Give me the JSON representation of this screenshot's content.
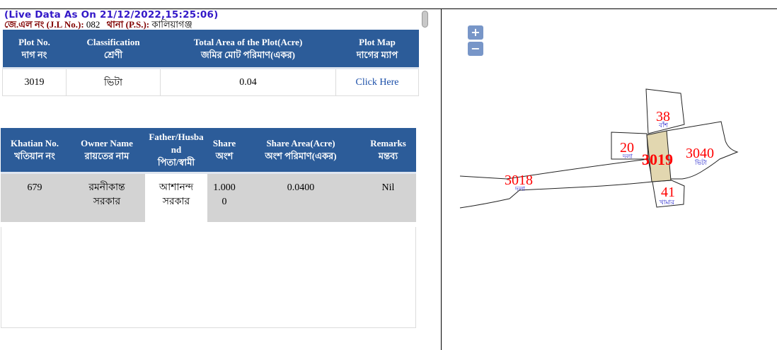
{
  "header": {
    "live_data": "(Live Data As On 21/12/2022,15:25:06)",
    "jl_label": "জে.এল নং (J.L No.):",
    "jl_value": "082",
    "ps_label": "থানা (P.S.):",
    "ps_value": "কালিয়াগঞ্জ"
  },
  "plot_table": {
    "headers": [
      {
        "en": "Plot No.",
        "bn": "দাগ নং"
      },
      {
        "en": "Classification",
        "bn": "শ্রেণী"
      },
      {
        "en": "Total Area of the Plot(Acre)",
        "bn": "জমির মোট পরিমাণ(একর)"
      },
      {
        "en": "Plot Map",
        "bn": "দাগের ম্যাপ"
      }
    ],
    "row": {
      "plot_no": "3019",
      "classification": "ভিটা",
      "total_area": "0.04",
      "plot_map_link": "Click Here"
    }
  },
  "owner_table": {
    "headers": [
      {
        "en": "Khatian No.",
        "bn": "খতিয়ান নং"
      },
      {
        "en": "Owner Name",
        "bn": "রায়তের নাম"
      },
      {
        "en": "Father/Husband",
        "bn": "পিতা/স্বামী"
      },
      {
        "en": "Share",
        "bn": "অংশ"
      },
      {
        "en": "Share Area(Acre)",
        "bn": "অংশ পরিমাণ(একর)"
      },
      {
        "en": "Remarks",
        "bn": "মন্তব্য"
      }
    ],
    "row": {
      "khatian_no": "679",
      "owner_name": "রমনীকান্ত সরকার",
      "father_husband": "আশানন্দ সরকার",
      "share": "1.0000",
      "share_area": "0.0400",
      "remarks": "Nil"
    }
  },
  "map": {
    "zoom_in": "+",
    "zoom_out": "−",
    "selected_fill": "#e2d7b0",
    "label_color": "#ff0000",
    "class_color": "#2222cc",
    "plots": [
      {
        "no": "38",
        "cls": "বাঁশ"
      },
      {
        "no": "20",
        "cls": "দলা"
      },
      {
        "no": "3019",
        "cls": ""
      },
      {
        "no": "3040",
        "cls": "ভিটা"
      },
      {
        "no": "3018",
        "cls": "দলা"
      },
      {
        "no": "41",
        "cls": "খামার"
      }
    ]
  }
}
